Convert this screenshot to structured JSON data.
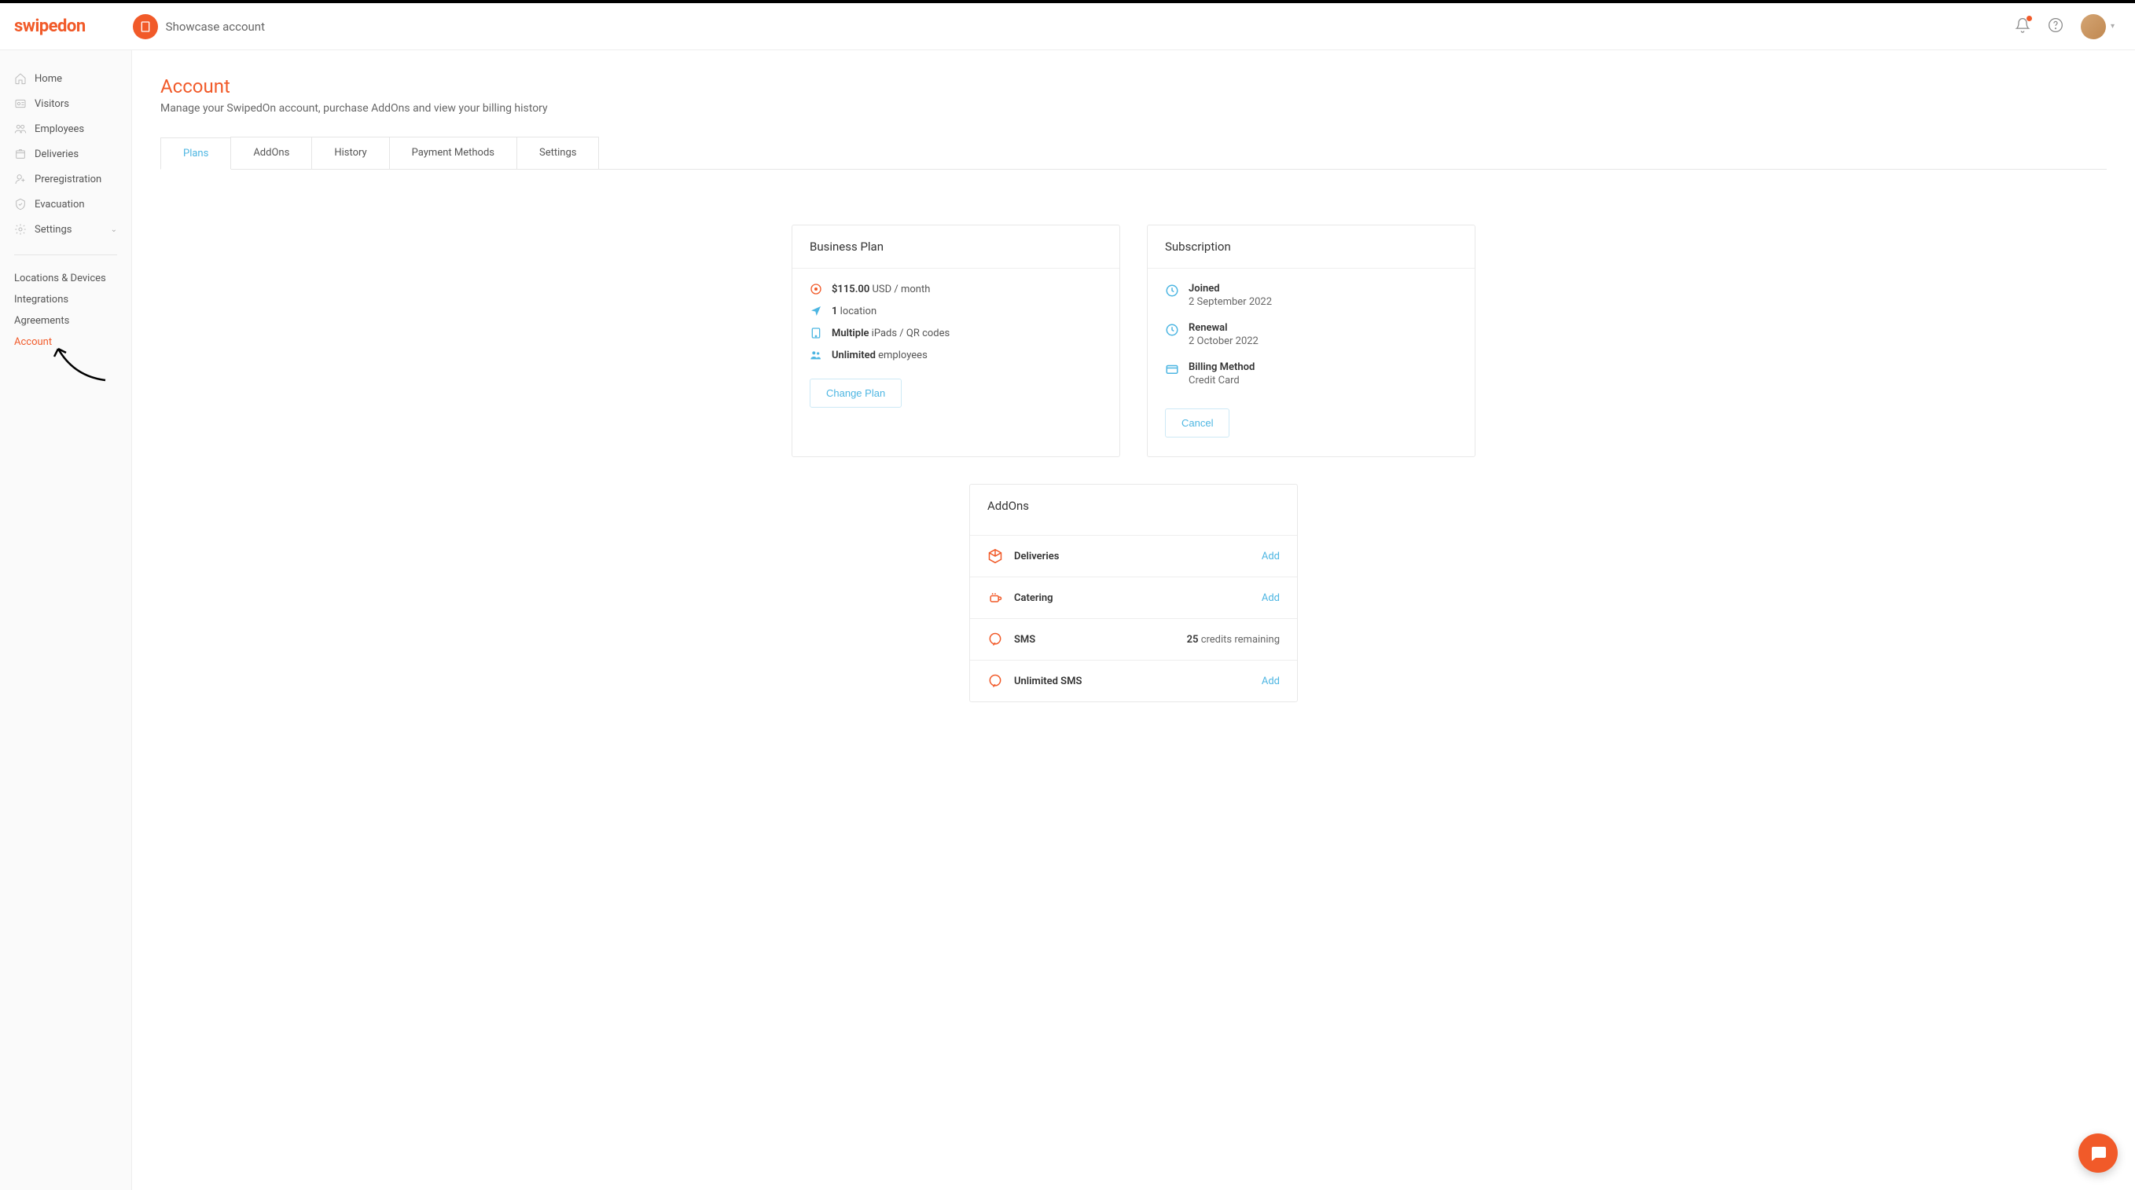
{
  "brand": "swipedon",
  "header": {
    "account_label": "Showcase account"
  },
  "sidebar": {
    "items": [
      {
        "label": "Home"
      },
      {
        "label": "Visitors"
      },
      {
        "label": "Employees"
      },
      {
        "label": "Deliveries"
      },
      {
        "label": "Preregistration"
      },
      {
        "label": "Evacuation"
      },
      {
        "label": "Settings"
      }
    ],
    "sub_items": [
      {
        "label": "Locations & Devices"
      },
      {
        "label": "Integrations"
      },
      {
        "label": "Agreements"
      },
      {
        "label": "Account"
      }
    ]
  },
  "page": {
    "title": "Account",
    "subtitle": "Manage your SwipedOn account, purchase AddOns and view your billing history"
  },
  "tabs": [
    {
      "label": "Plans"
    },
    {
      "label": "AddOns"
    },
    {
      "label": "History"
    },
    {
      "label": "Payment Methods"
    },
    {
      "label": "Settings"
    }
  ],
  "plan_card": {
    "title": "Business Plan",
    "price_amount": "$115.00",
    "price_suffix": "USD / month",
    "locations_count": "1",
    "locations_suffix": "location",
    "devices_prefix": "Multiple",
    "devices_suffix": "iPads / QR codes",
    "employees_prefix": "Unlimited",
    "employees_suffix": "employees",
    "change_btn": "Change Plan"
  },
  "subscription_card": {
    "title": "Subscription",
    "joined_label": "Joined",
    "joined_value": "2 September 2022",
    "renewal_label": "Renewal",
    "renewal_value": "2 October 2022",
    "billing_label": "Billing Method",
    "billing_value": "Credit Card",
    "cancel_btn": "Cancel"
  },
  "addons_card": {
    "title": "AddOns",
    "rows": [
      {
        "name": "Deliveries",
        "action": "Add"
      },
      {
        "name": "Catering",
        "action": "Add"
      },
      {
        "name": "SMS",
        "status_bold": "25",
        "status_rest": "credits remaining"
      },
      {
        "name": "Unlimited SMS",
        "action": "Add"
      }
    ]
  }
}
